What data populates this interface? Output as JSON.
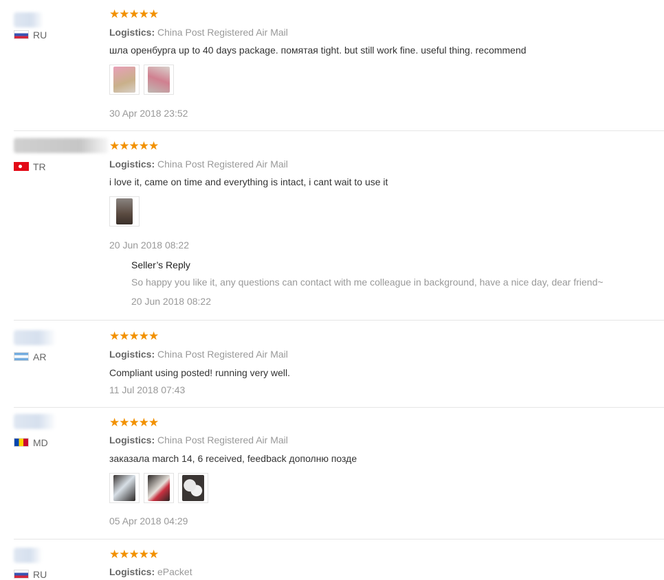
{
  "logistics_label": "Logistics:",
  "stars_glyph": "★★★★★",
  "colors": {
    "star": "#f29100",
    "muted": "#999999",
    "text": "#333333"
  },
  "reviews": [
    {
      "country": "RU",
      "flag": "ru-flag-icon",
      "rating": 5,
      "logistics": "China Post Registered Air Mail",
      "text": "шла оренбурга up to 40 days package. помятая tight. but still work fine. useful thing. recommend",
      "photos": 2,
      "date": "30 Apr 2018 23:52"
    },
    {
      "country": "TR",
      "flag": "tr-flag-icon",
      "rating": 5,
      "logistics": "China Post Registered Air Mail",
      "text": "i love it, came on time and everything is intact, i cant wait to use it",
      "photos": 1,
      "date": "20 Jun 2018 08:22",
      "seller_reply": {
        "title": "Seller’s Reply",
        "text": "So happy you like it, any questions can contact with me colleague in background, have a nice day, dear friend~",
        "date": "20 Jun 2018 08:22"
      }
    },
    {
      "country": "AR",
      "flag": "ar-flag-icon",
      "rating": 5,
      "logistics": "China Post Registered Air Mail",
      "text": "Compliant using posted! running very well.",
      "photos": 0,
      "date": "11 Jul 2018 07:43"
    },
    {
      "country": "MD",
      "flag": "md-flag-icon",
      "rating": 5,
      "logistics": "China Post Registered Air Mail",
      "text": "заказала march 14, 6 received, feedback дополню позде",
      "photos": 3,
      "date": "05 Apr 2018 04:29"
    },
    {
      "country": "RU",
      "flag": "ru-flag-icon",
      "rating": 5,
      "logistics": "ePacket"
    }
  ]
}
